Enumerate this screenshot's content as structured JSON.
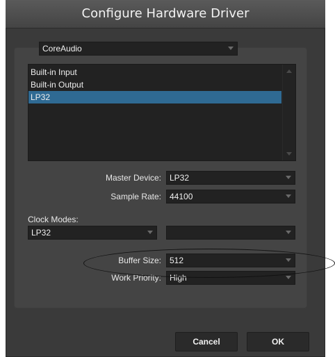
{
  "window": {
    "title": "Configure Hardware Driver"
  },
  "driver_select": {
    "value": "CoreAudio"
  },
  "devices": {
    "items": [
      {
        "label": "Built-in Input",
        "selected": false
      },
      {
        "label": "Built-in Output",
        "selected": false
      },
      {
        "label": "LP32",
        "selected": true
      }
    ]
  },
  "master_device": {
    "label": "Master Device:",
    "value": "LP32"
  },
  "sample_rate": {
    "label": "Sample Rate:",
    "value": "44100"
  },
  "clock_modes": {
    "label": "Clock Modes:",
    "primary_value": "LP32",
    "secondary_value": ""
  },
  "buffer_size": {
    "label": "Buffer Size:",
    "value": "512"
  },
  "work_priority": {
    "label": "Work Priority:",
    "value": "High"
  },
  "buttons": {
    "cancel": "Cancel",
    "ok": "OK"
  },
  "colors": {
    "selection": "#2f6a93",
    "dialog_bg": "#3a3a3a",
    "field_bg": "#222222"
  }
}
